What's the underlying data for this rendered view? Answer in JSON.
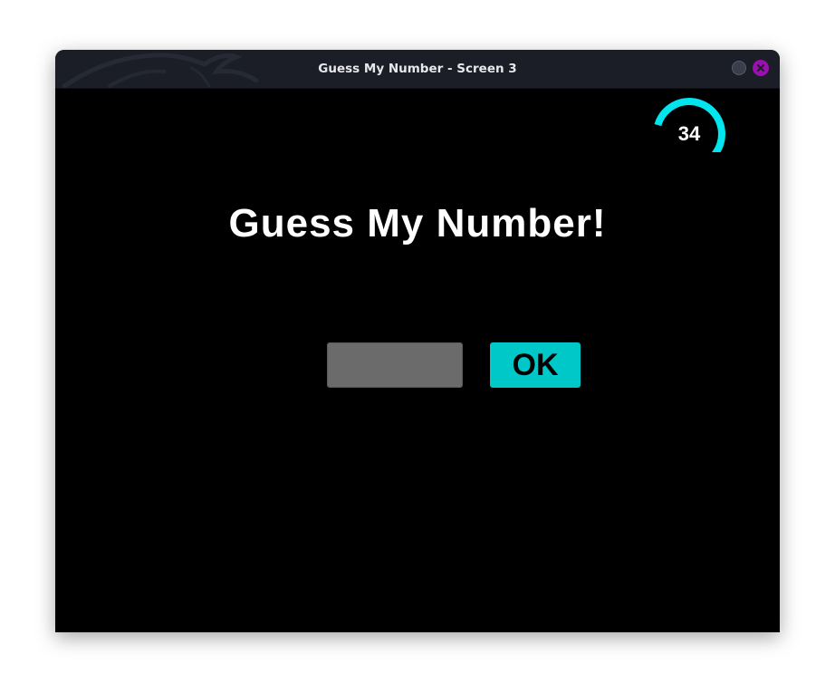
{
  "window": {
    "title": "Guess My Number - Screen 3"
  },
  "timer": {
    "value": "34",
    "fraction_remaining": 0.57,
    "color": "#00e5ee"
  },
  "game": {
    "heading": "Guess My Number!",
    "guess_input": {
      "value": "",
      "placeholder": ""
    },
    "ok_label": "OK"
  },
  "colors": {
    "titlebar": "#1b1e26",
    "background": "#000000",
    "input_fill": "#6b6b6b",
    "ok_button": "#00c8c8",
    "close_button": "#9a0fb0"
  },
  "icons": {
    "minimize": "minimize-circle-icon",
    "close": "close-x-icon",
    "titlebar_art": "dragon-watermark-icon"
  }
}
